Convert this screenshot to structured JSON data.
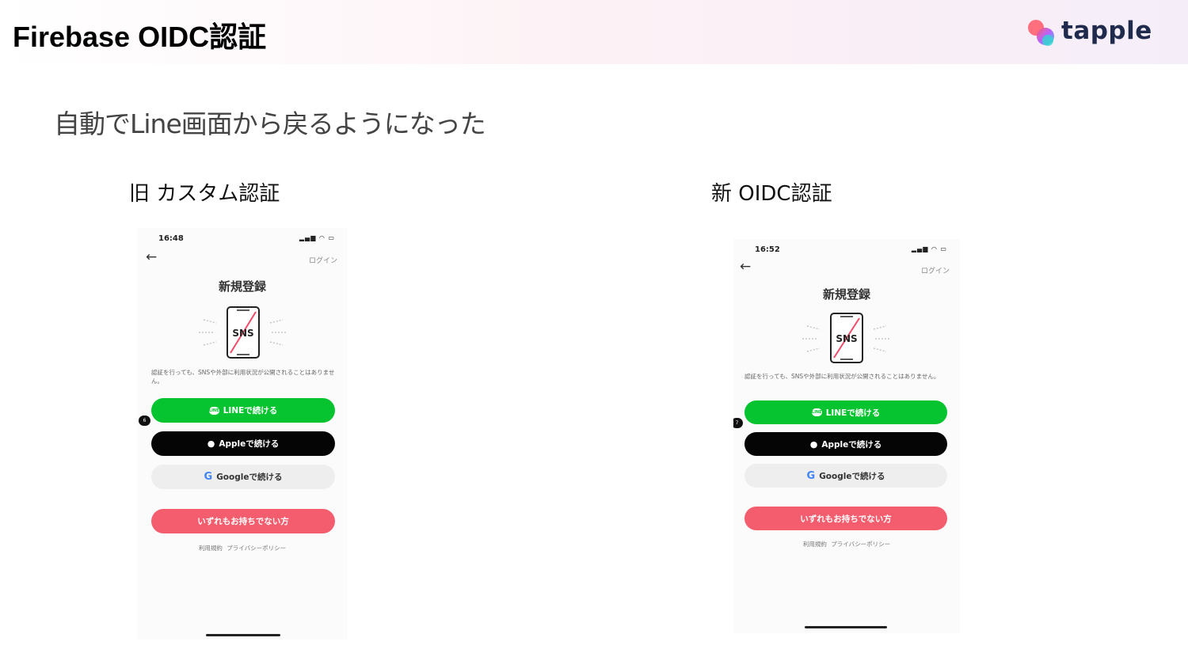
{
  "header": {
    "title": "Firebase OIDC認証",
    "logo_text": "tapple"
  },
  "subtitle": "自動でLine画面から戻るようになった",
  "columns": [
    {
      "label": "旧 カスタム認証",
      "phone": {
        "time": "16:48",
        "login_link": "ログイン",
        "title": "新規登録",
        "illustration_text": "SNS",
        "disclaimer": "認証を行っても、SNSや外部に利用状況が公開されることはありません。",
        "line_button": "LINEで続ける",
        "apple_button": "Appleで続ける",
        "google_button": "Googleで続ける",
        "none_button": "いずれもお持ちでない方",
        "step_badge": "6",
        "footer": "利用規約 プライバシーポリシー"
      }
    },
    {
      "label": "新 OIDC認証",
      "phone": {
        "time": "16:52",
        "login_link": "ログイン",
        "title": "新規登録",
        "illustration_text": "SNS",
        "disclaimer": "認証を行っても、SNSや外部に利用状況が公開されることはありません。",
        "line_button": "LINEで続ける",
        "apple_button": "Appleで続ける",
        "google_button": "Googleで続ける",
        "none_button": "いずれもお持ちでない方",
        "step_badge": "7",
        "footer": "利用規約 プライバシーポリシー"
      }
    }
  ],
  "icons": {
    "back": "arrow-left-icon",
    "apple": "apple-logo-icon",
    "google": "google-logo-icon",
    "line": "line-logo-icon"
  },
  "colors": {
    "line_green": "#06c42f",
    "apple_black": "#050505",
    "google_gray": "#eeeeef",
    "accent_pink": "#f45d6e",
    "logo_navy": "#1f2a4d"
  }
}
